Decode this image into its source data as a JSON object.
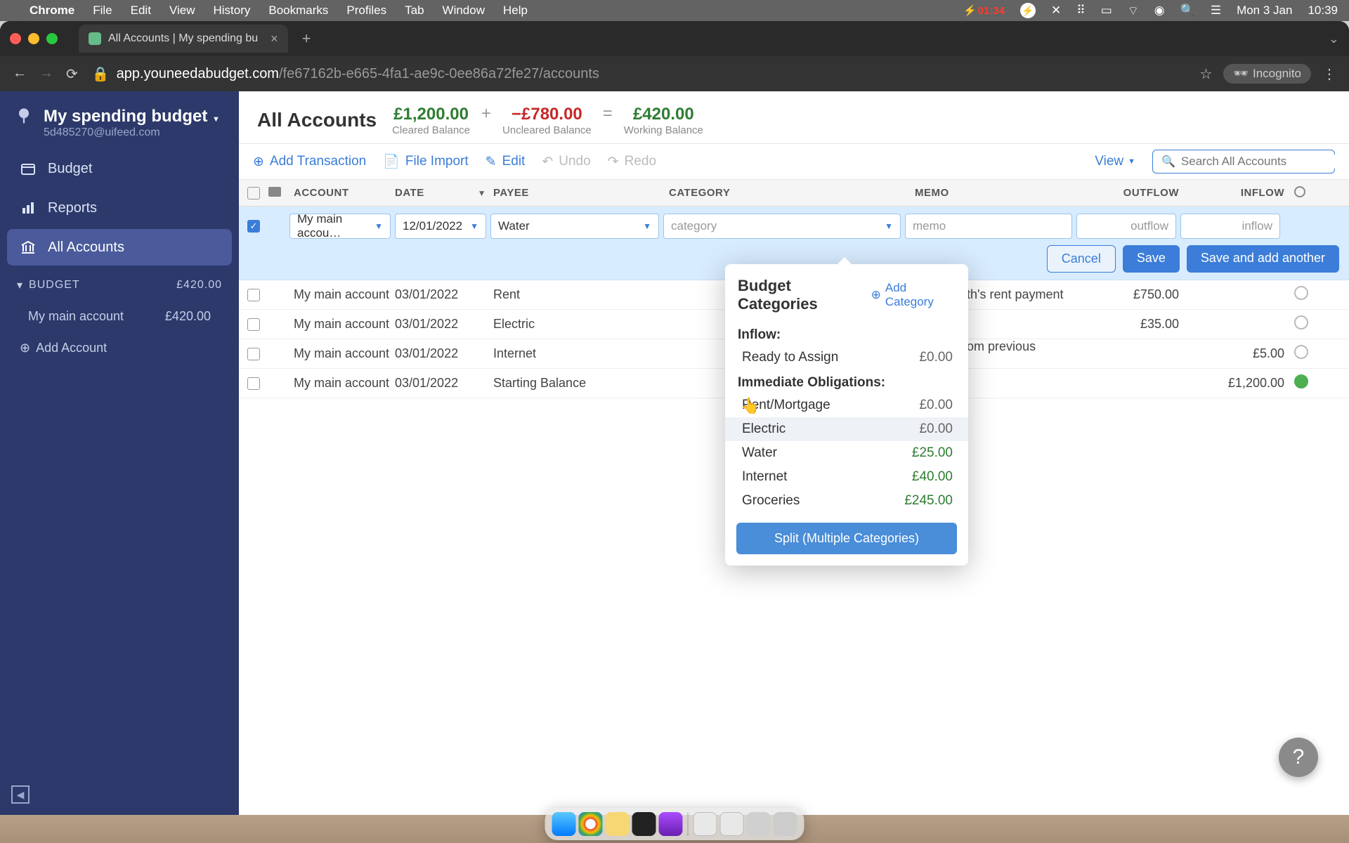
{
  "menubar": {
    "app": "Chrome",
    "items": [
      "File",
      "Edit",
      "View",
      "History",
      "Bookmarks",
      "Profiles",
      "Tab",
      "Window",
      "Help"
    ],
    "battery": "01:34",
    "date": "Mon 3 Jan",
    "time": "10:39"
  },
  "browser": {
    "tab_title": "All Accounts | My spending bu",
    "url_host": "app.youneedabudget.com",
    "url_path": "/fe67162b-e665-4fa1-ae9c-0ee86a72fe27/accounts",
    "incognito": "Incognito"
  },
  "sidebar": {
    "budget_name": "My spending budget",
    "email": "5d485270@uifeed.com",
    "nav": {
      "budget": "Budget",
      "reports": "Reports",
      "all_accounts": "All Accounts"
    },
    "section_budget": "BUDGET",
    "section_amount": "£420.00",
    "account": {
      "name": "My main account",
      "amount": "£420.00"
    },
    "add_account": "Add Account"
  },
  "header": {
    "title": "All Accounts",
    "cleared": {
      "amount": "£1,200.00",
      "label": "Cleared Balance"
    },
    "uncleared": {
      "amount": "−£780.00",
      "label": "Uncleared Balance"
    },
    "working": {
      "amount": "£420.00",
      "label": "Working Balance"
    }
  },
  "toolbar": {
    "add": "Add Transaction",
    "import": "File Import",
    "edit": "Edit",
    "undo": "Undo",
    "redo": "Redo",
    "view": "View",
    "search_placeholder": "Search All Accounts"
  },
  "columns": {
    "account": "ACCOUNT",
    "date": "DATE",
    "payee": "PAYEE",
    "category": "CATEGORY",
    "memo": "MEMO",
    "outflow": "OUTFLOW",
    "inflow": "INFLOW"
  },
  "edit_row": {
    "account": "My main accou…",
    "date": "12/01/2022",
    "payee": "Water",
    "category_placeholder": "category",
    "memo_placeholder": "memo",
    "outflow_placeholder": "outflow",
    "inflow_placeholder": "inflow",
    "cancel": "Cancel",
    "save": "Save",
    "save_another": "Save and add another"
  },
  "dropdown": {
    "title": "Budget Categories",
    "add": "Add Category",
    "groups": [
      {
        "name": "Inflow:",
        "items": [
          {
            "label": "Ready to Assign",
            "amount": "£0.00",
            "green": false
          }
        ]
      },
      {
        "name": "Immediate Obligations:",
        "items": [
          {
            "label": "Rent/Mortgage",
            "amount": "£0.00",
            "green": false
          },
          {
            "label": "Electric",
            "amount": "£0.00",
            "green": false,
            "hover": true
          },
          {
            "label": "Water",
            "amount": "£25.00",
            "green": true
          },
          {
            "label": "Internet",
            "amount": "£40.00",
            "green": true
          },
          {
            "label": "Groceries",
            "amount": "£245.00",
            "green": true
          }
        ]
      }
    ],
    "split": "Split (Multiple Categories)"
  },
  "rows": [
    {
      "account": "My main account",
      "date": "03/01/2022",
      "payee": "Rent",
      "memo": "This month's rent payment",
      "outflow": "£750.00",
      "inflow": "",
      "cleared": false
    },
    {
      "account": "My main account",
      "date": "03/01/2022",
      "payee": "Electric",
      "memo": "",
      "outflow": "£35.00",
      "inflow": "",
      "cleared": false
    },
    {
      "account": "My main account",
      "date": "03/01/2022",
      "payee": "Internet",
      "memo": "Refund from previous overpa…",
      "outflow": "",
      "inflow": "£5.00",
      "cleared": false
    },
    {
      "account": "My main account",
      "date": "03/01/2022",
      "payee": "Starting Balance",
      "memo": "",
      "outflow": "",
      "inflow": "£1,200.00",
      "cleared": true
    }
  ]
}
